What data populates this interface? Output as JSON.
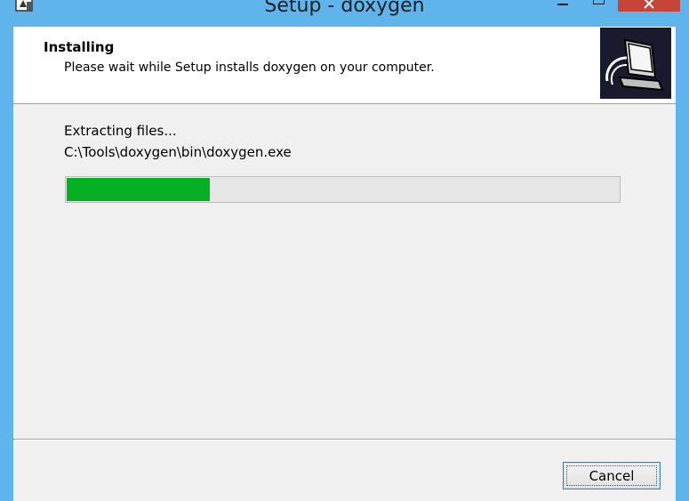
{
  "window": {
    "title": "Setup - doxygen",
    "app_icon": "installer-icon",
    "controls": {
      "minimize": "minimize-icon",
      "maximize": "maximize-icon",
      "close": "close-icon"
    }
  },
  "header": {
    "title": "Installing",
    "subtitle": "Please wait while Setup installs doxygen on your computer.",
    "logo": "computer-install-logo"
  },
  "progress": {
    "status": "Extracting files...",
    "current_file": "C:\\Tools\\doxygen\\bin\\doxygen.exe",
    "fraction": 0.26,
    "fill_color": "#06b025"
  },
  "buttons": {
    "cancel": "Cancel"
  },
  "colors": {
    "titlebar": "#5fb4ec",
    "close_button": "#c7443a",
    "client_background": "#f0f0f0"
  }
}
